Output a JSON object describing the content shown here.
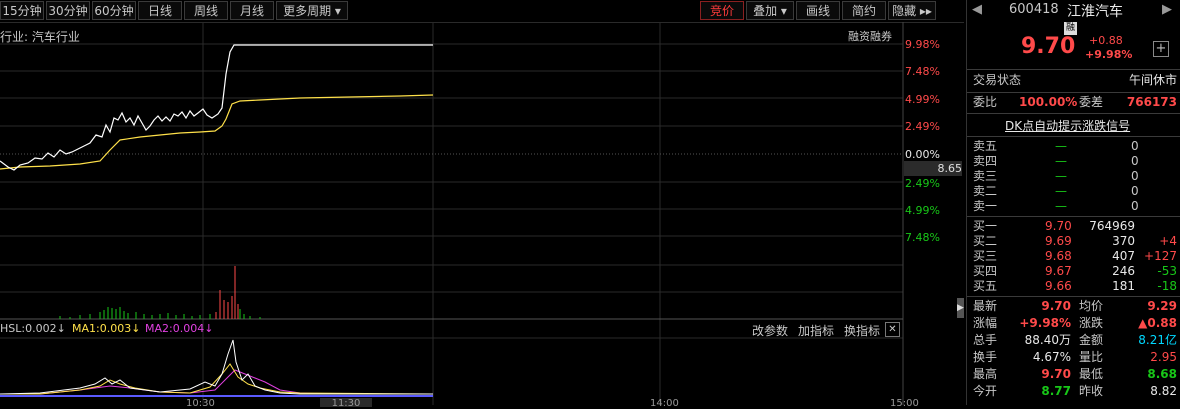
{
  "toolbar": {
    "left_tabs": [
      "15分钟",
      "30分钟",
      "60分钟",
      "日线",
      "周线",
      "月线",
      "更多周期 ▾"
    ],
    "right_tabs": [
      "竞价",
      "叠加 ▾",
      "画线",
      "简约",
      "隐藏 ▸▸"
    ]
  },
  "chart": {
    "industry_label": "行业: 汽车行业",
    "margin_label": "融资融券",
    "pct_labels_up": [
      "9.98%",
      "7.48%",
      "4.99%",
      "2.49%"
    ],
    "zero_label": "0.00%",
    "pct_labels_down": [
      "2.49%",
      "4.99%",
      "7.48%"
    ],
    "price_marker": "8.65",
    "indicator": {
      "hsl": "HSL:0.002↓",
      "ma1": "MA1:0.003↓",
      "ma2": "MA2:0.004↓",
      "change_params": "改参数",
      "add_indicator": "加指标",
      "swap_indicator": "换指标",
      "close": "✕"
    },
    "time_labels": [
      "10:30",
      "11:30",
      "14:00",
      "15:00"
    ],
    "colors": {
      "price": "#ffffff",
      "avg": "#ffe14a",
      "ma2": "#e040e0",
      "up": "#ff4a4a",
      "down": "#18c718"
    }
  },
  "quote": {
    "code": "600418",
    "name": "江淮汽车",
    "badge": "融",
    "price": "9.70",
    "change": "+0.88",
    "change_pct": "+9.98%",
    "trade_status_label": "交易状态",
    "trade_status": "午间休市",
    "weibi_label": "委比",
    "weibi": "100.00%",
    "weicha_label": "委差",
    "weicha": "766173",
    "signal": "DK点自动提示涨跌信号",
    "asks": [
      {
        "label": "卖五",
        "price": "—",
        "vol": "0"
      },
      {
        "label": "卖四",
        "price": "—",
        "vol": "0"
      },
      {
        "label": "卖三",
        "price": "—",
        "vol": "0"
      },
      {
        "label": "卖二",
        "price": "—",
        "vol": "0"
      },
      {
        "label": "卖一",
        "price": "—",
        "vol": "0"
      }
    ],
    "bids": [
      {
        "label": "买一",
        "price": "9.70",
        "vol": "764969",
        "chg": ""
      },
      {
        "label": "买二",
        "price": "9.69",
        "vol": "370",
        "chg": "+4"
      },
      {
        "label": "买三",
        "price": "9.68",
        "vol": "407",
        "chg": "+127"
      },
      {
        "label": "买四",
        "price": "9.67",
        "vol": "246",
        "chg": "-53"
      },
      {
        "label": "买五",
        "price": "9.66",
        "vol": "181",
        "chg": "-18"
      }
    ],
    "stats": [
      {
        "l1": "最新",
        "v1": "9.70",
        "l2": "均价",
        "v2": "9.29"
      },
      {
        "l1": "涨幅",
        "v1": "+9.98%",
        "l2": "涨跌",
        "v2": "▲0.88"
      },
      {
        "l1": "总手",
        "v1": "88.40万",
        "l2": "金额",
        "v2": "8.21亿"
      },
      {
        "l1": "换手",
        "v1": "4.67%",
        "l2": "量比",
        "v2": "2.95"
      },
      {
        "l1": "最高",
        "v1": "9.70",
        "l2": "最低",
        "v2": "8.68"
      },
      {
        "l1": "今开",
        "v1": "8.77",
        "l2": "昨收",
        "v2": "8.82"
      }
    ]
  }
}
